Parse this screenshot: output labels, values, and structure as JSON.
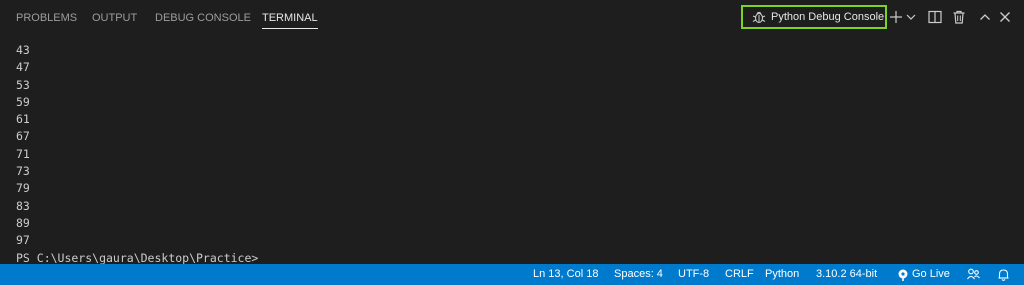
{
  "tabs": {
    "problems": "PROBLEMS",
    "output": "OUTPUT",
    "debug_console": "DEBUG CONSOLE",
    "terminal": "TERMINAL"
  },
  "toolbar": {
    "terminal_name": "Python Debug Console",
    "highlight_color": "#7ed321",
    "icons": [
      "bug-icon",
      "add-icon",
      "chevron-down-icon",
      "split-icon",
      "trash-icon",
      "chevron-up-icon",
      "close-icon"
    ]
  },
  "terminal": {
    "lines": [
      "43",
      "47",
      "53",
      "59",
      "61",
      "67",
      "71",
      "73",
      "79",
      "83",
      "89",
      "97",
      "PS C:\\Users\\gaura\\Desktop\\Practice>"
    ]
  },
  "statusbar": {
    "background": "#007acc",
    "position": "Ln 13, Col 18",
    "spaces": "Spaces: 4",
    "encoding": "UTF-8",
    "eol": "CRLF",
    "language": "Python",
    "interpreter": "3.10.2 64-bit",
    "go_live": "Go Live"
  }
}
